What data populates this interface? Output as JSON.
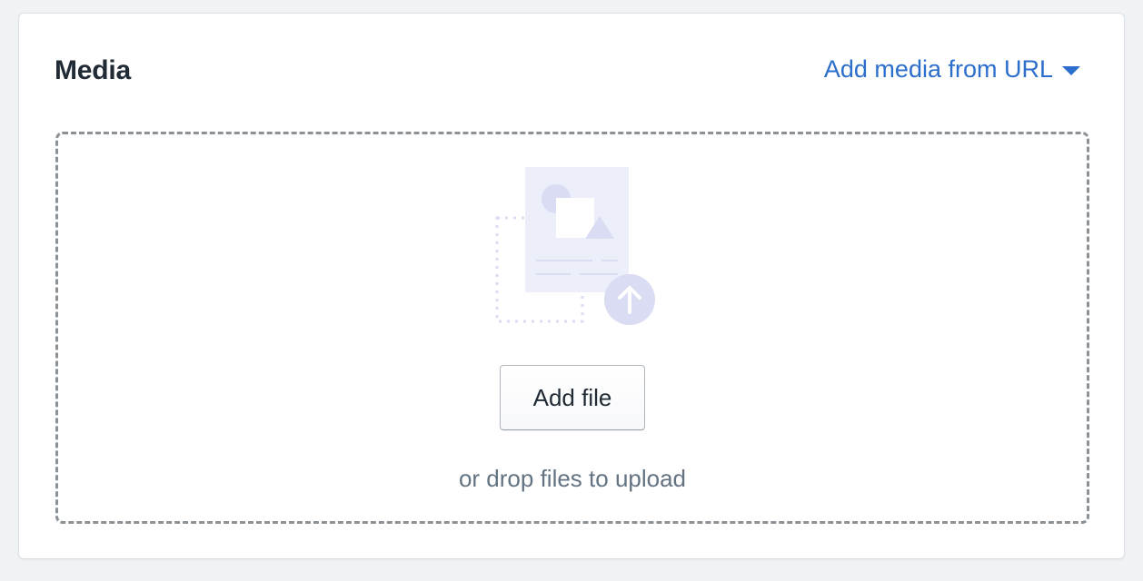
{
  "card": {
    "title": "Media",
    "add_url_label": "Add media from URL"
  },
  "dropzone": {
    "add_file_label": "Add file",
    "hint": "or drop files to upload",
    "illustration_icon": "image-upload-icon"
  },
  "colors": {
    "link": "#2c6ecb",
    "title": "#212b36",
    "hint": "#637381",
    "dropzone_border": "#8c9196",
    "illustration_bg": "#eceefa",
    "illustration_accent": "#d9dcf2"
  }
}
